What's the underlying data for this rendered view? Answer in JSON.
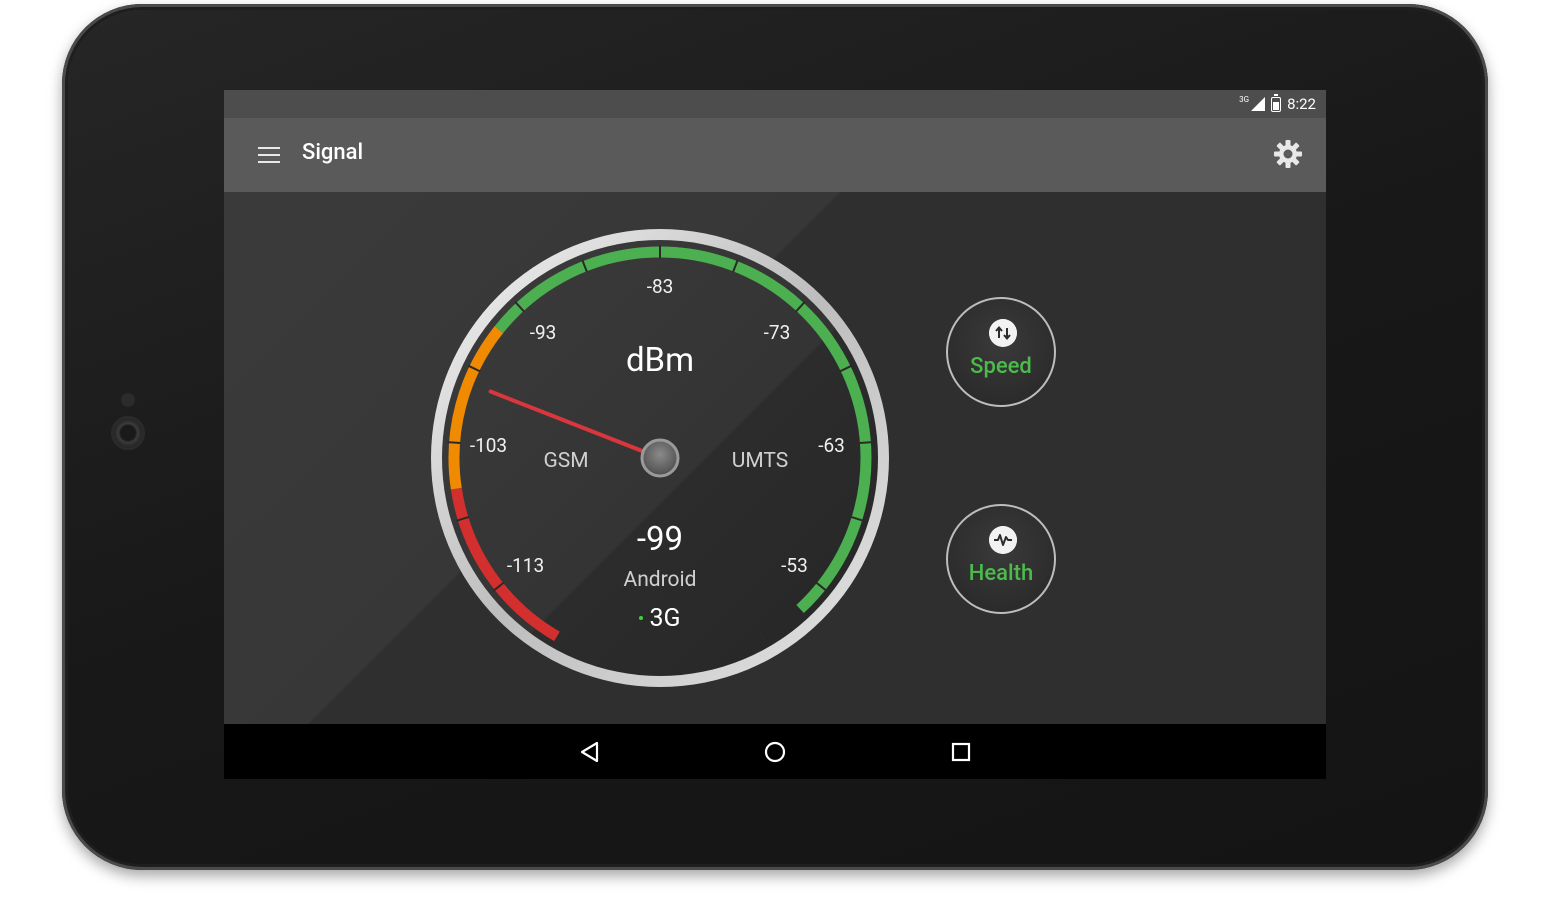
{
  "status_bar": {
    "network": "3G",
    "time": "8:22"
  },
  "app_bar": {
    "title": "Signal",
    "menu_icon": "menu-icon",
    "settings_icon": "gear-icon"
  },
  "gauge": {
    "unit": "dBm",
    "ticks": [
      "-113",
      "-103",
      "-93",
      "-83",
      "-73",
      "-63",
      "-53"
    ],
    "left_label": "GSM",
    "right_label": "UMTS",
    "value": "-99",
    "source": "Android",
    "network_type": "3G",
    "needle_value_dbm": -99,
    "range_dbm": [
      -118,
      -48
    ],
    "zones": [
      {
        "from": -118,
        "to": -106,
        "color": "#d32f2f"
      },
      {
        "from": -106,
        "to": -95,
        "color": "#f08a00"
      },
      {
        "from": -95,
        "to": -51,
        "color": "#4caf50"
      }
    ],
    "needle_color": "#d9363e",
    "indicator_color": "#3cd23c"
  },
  "buttons": {
    "speed": {
      "label": "Speed",
      "icon": "up-down-arrows-icon"
    },
    "health": {
      "label": "Health",
      "icon": "pulse-icon"
    },
    "label_color": "#4cbb4c"
  },
  "nav": {
    "back": "back-icon",
    "home": "home-icon",
    "recents": "recents-icon"
  }
}
